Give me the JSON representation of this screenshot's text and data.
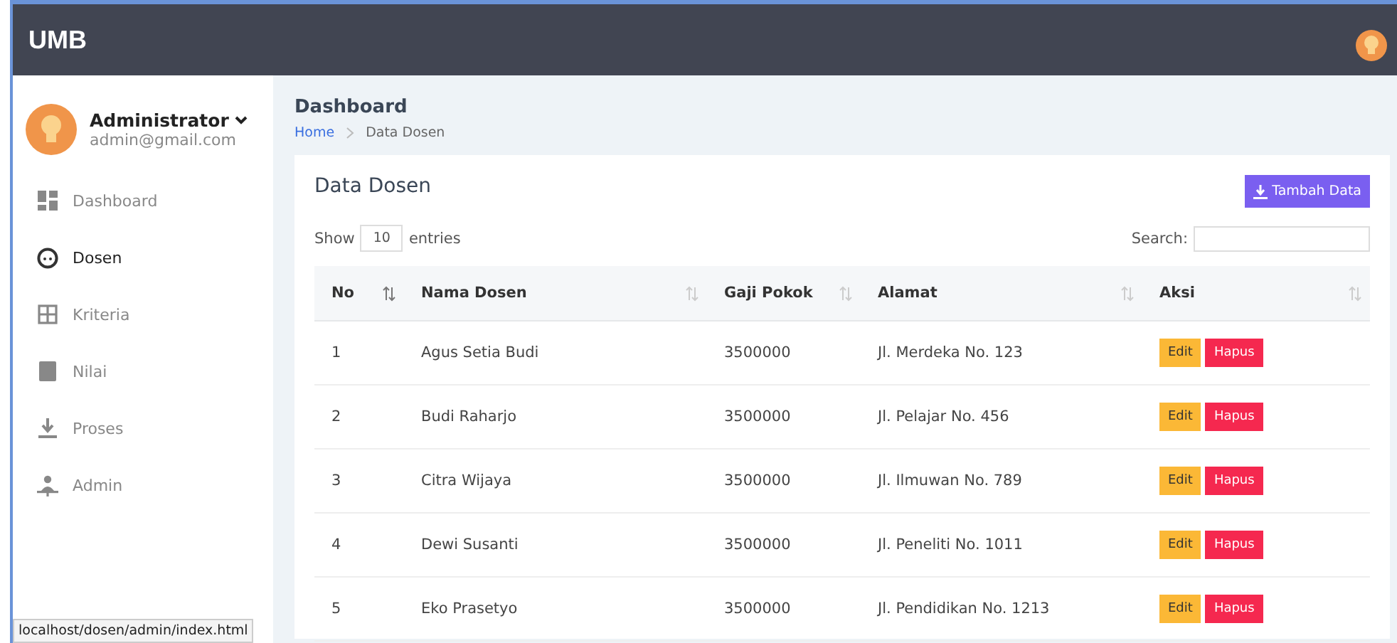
{
  "topbar": {
    "brand": "UMB"
  },
  "user": {
    "name": "Administrator",
    "email": "admin@gmail.com"
  },
  "sidebar": {
    "items": [
      {
        "label": "Dashboard",
        "selected": false
      },
      {
        "label": "Dosen",
        "selected": true
      },
      {
        "label": "Kriteria",
        "selected": false
      },
      {
        "label": "Nilai",
        "selected": false
      },
      {
        "label": "Proses",
        "selected": false
      },
      {
        "label": "Admin",
        "selected": false
      }
    ]
  },
  "page": {
    "title": "Dashboard",
    "breadcrumb": [
      "Home",
      "Data Dosen"
    ]
  },
  "card": {
    "title": "Data Dosen",
    "add_button": "Tambah Data",
    "show_label": "Show",
    "entries_value": "10",
    "entries_label": "entries",
    "search_label": "Search:"
  },
  "table": {
    "columns": [
      "No",
      "Nama Dosen",
      "Gaji Pokok",
      "Alamat",
      "Aksi"
    ],
    "rows": [
      {
        "cells": [
          "1",
          "Agus Setia Budi",
          "3500000",
          "Jl. Merdeka No. 123"
        ],
        "actions": [
          "Edit",
          "Hapus"
        ]
      },
      {
        "cells": [
          "2",
          "Budi Raharjo",
          "3500000",
          "Jl. Pelajar No. 456"
        ],
        "actions": [
          "Edit",
          "Hapus"
        ]
      },
      {
        "cells": [
          "3",
          "Citra Wijaya",
          "3500000",
          "Jl. Ilmuwan No. 789"
        ],
        "actions": [
          "Edit",
          "Hapus"
        ]
      },
      {
        "cells": [
          "4",
          "Dewi Susanti",
          "3500000",
          "Jl. Peneliti No. 1011"
        ],
        "actions": [
          "Edit",
          "Hapus"
        ]
      },
      {
        "cells": [
          "5",
          "Eko Prasetyo",
          "3500000",
          "Jl. Pendidikan No. 1213"
        ],
        "actions": [
          "Edit",
          "Hapus"
        ]
      }
    ]
  },
  "status_bar": {
    "url": "localhost/dosen/admin/index.html"
  }
}
